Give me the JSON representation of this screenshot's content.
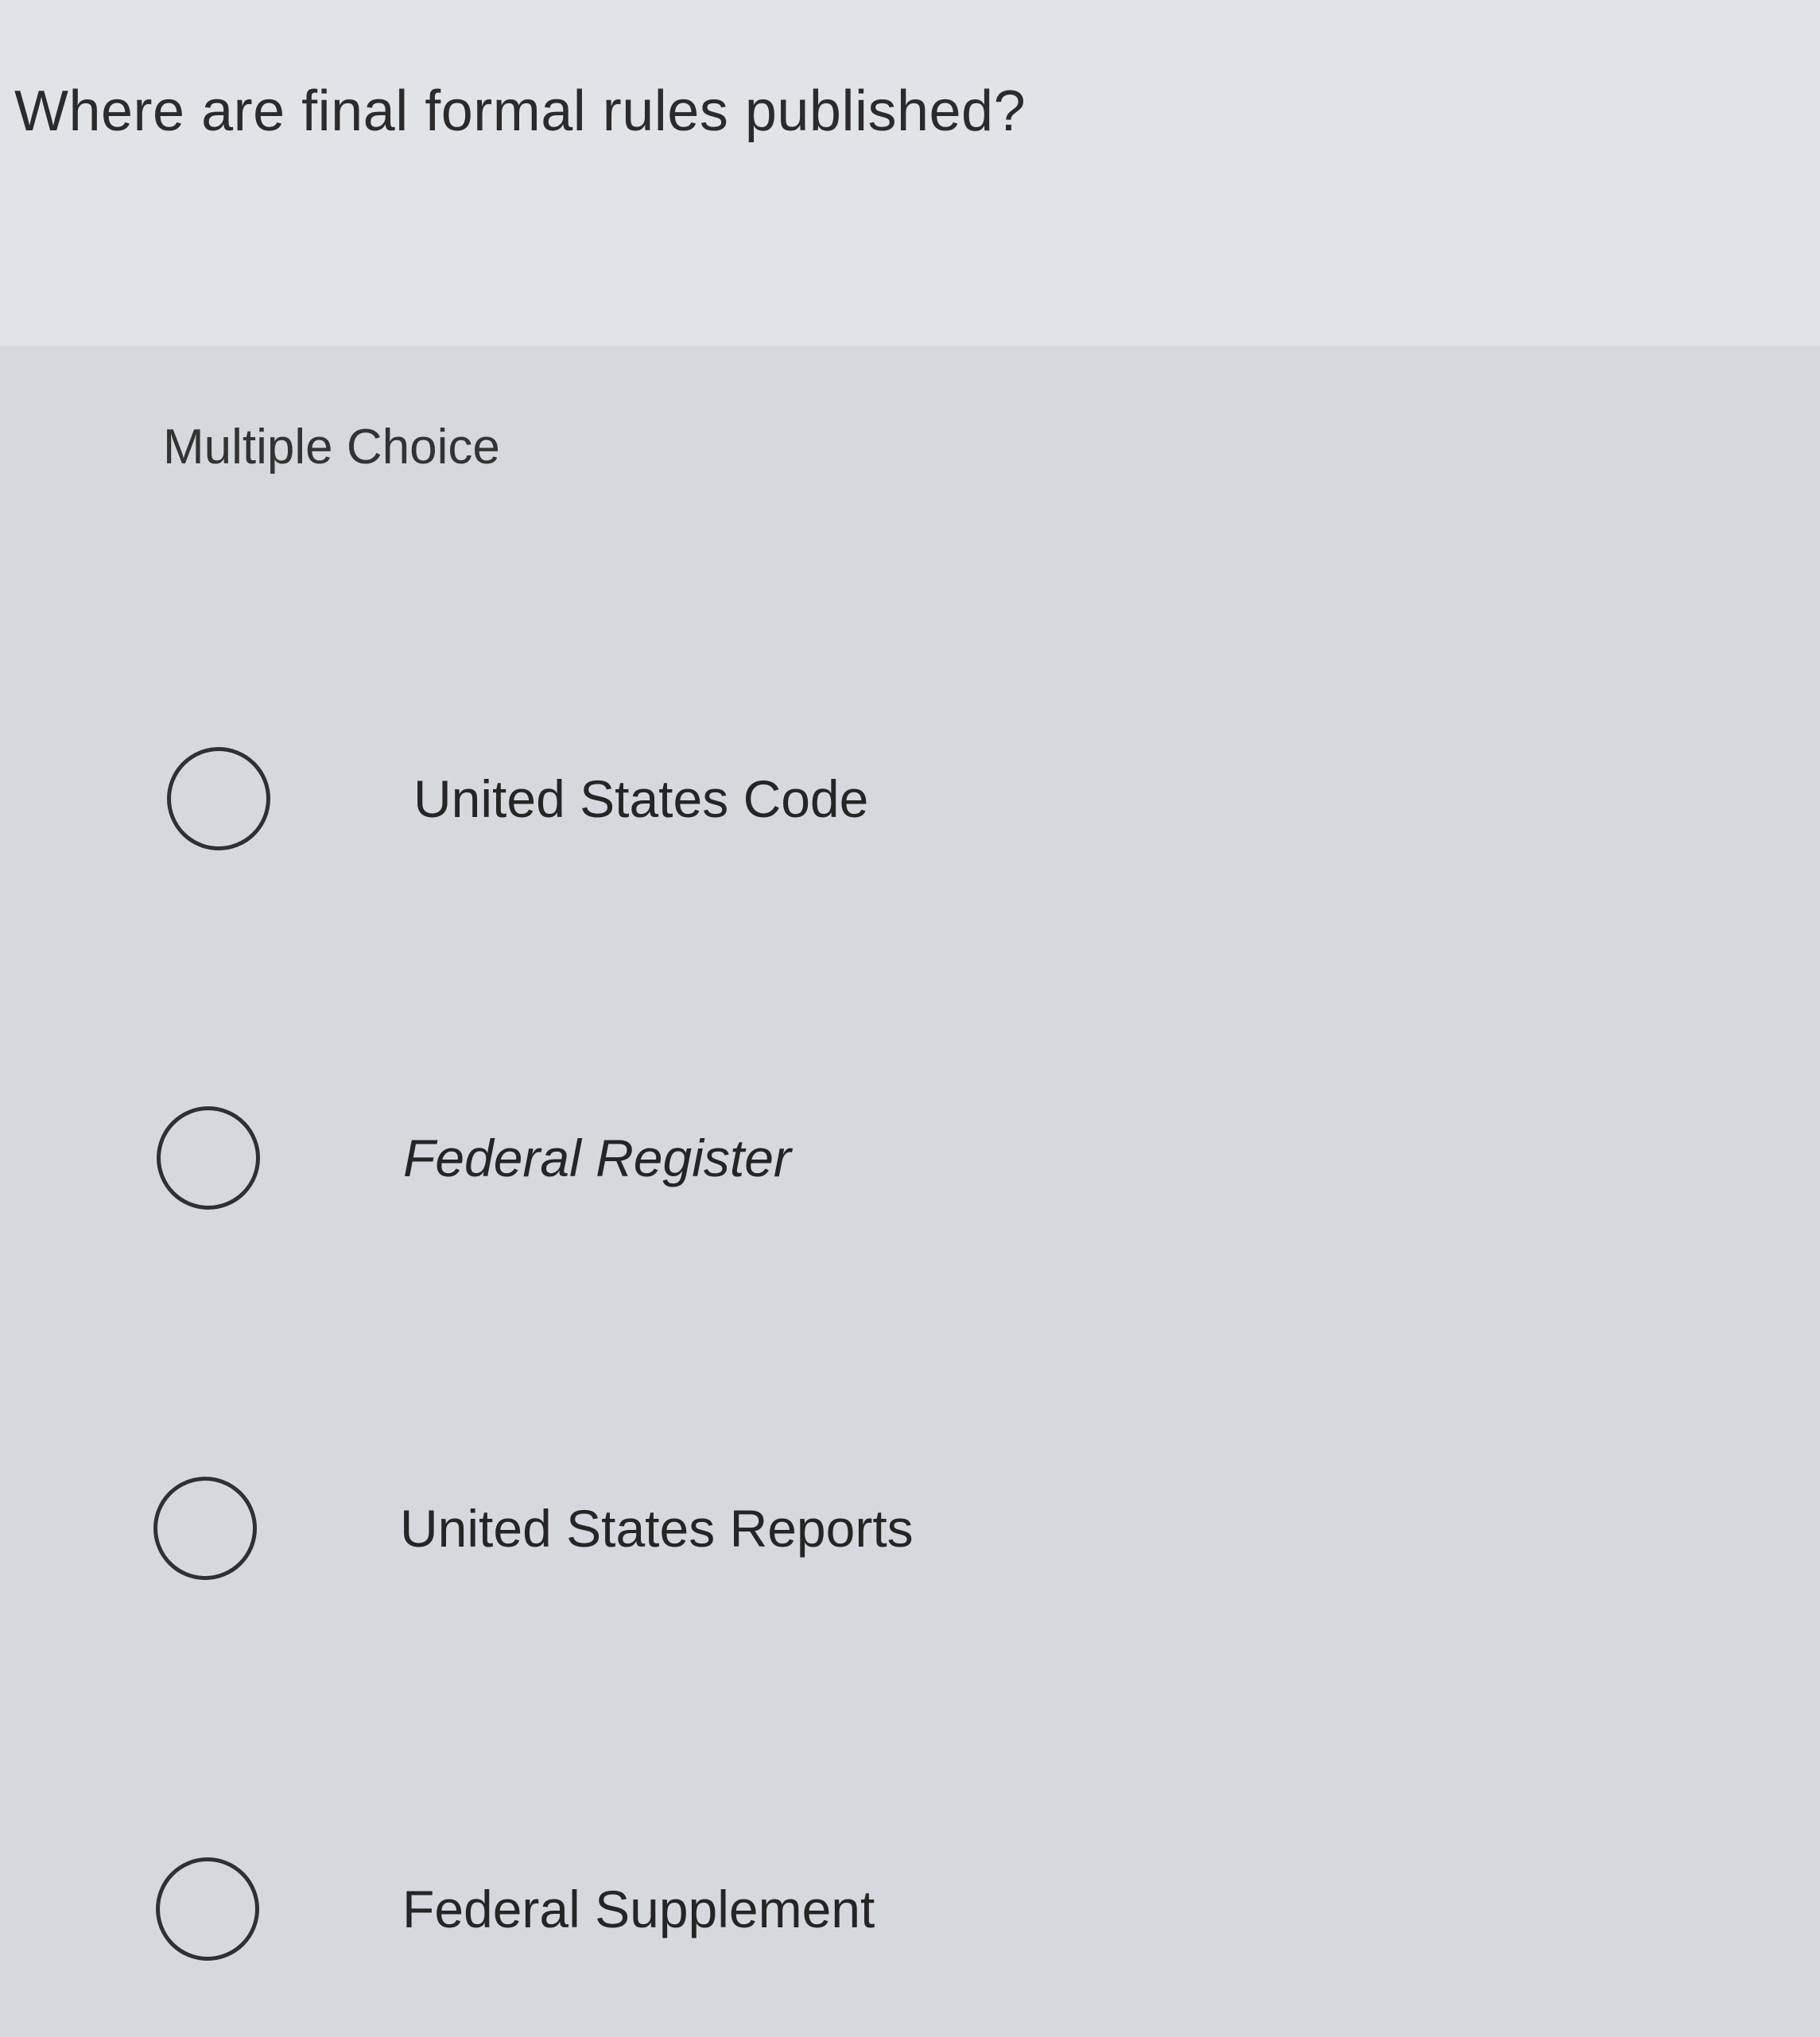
{
  "question": {
    "text": "Where are final formal rules published?"
  },
  "question_type": "Multiple Choice",
  "options": [
    {
      "label": "United States Code",
      "selected": false
    },
    {
      "label": "Federal Register",
      "selected": false
    },
    {
      "label": "United States Reports",
      "selected": false
    },
    {
      "label": "Federal Supplement",
      "selected": false
    }
  ]
}
